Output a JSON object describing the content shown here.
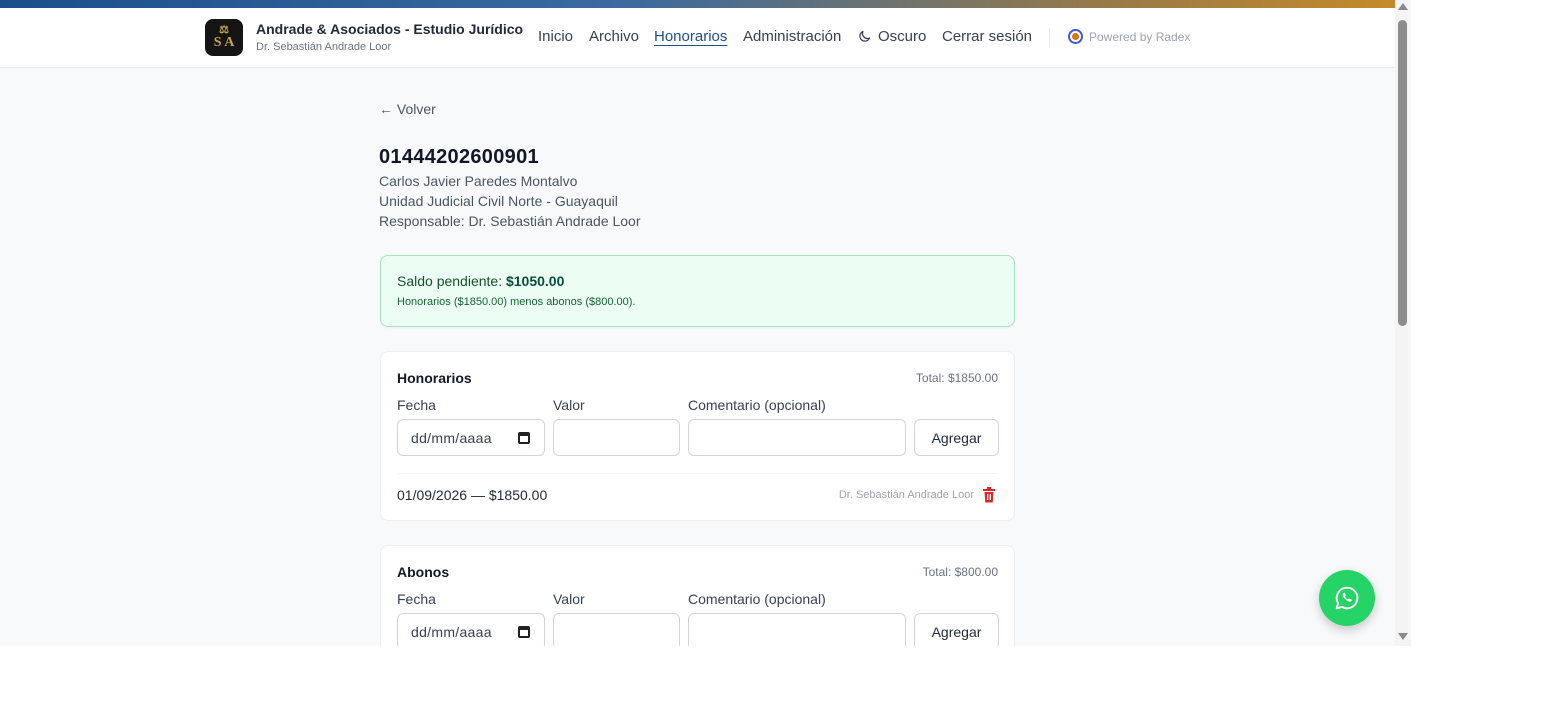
{
  "header": {
    "logo_text": "S A",
    "brand_title": "Andrade & Asociados - Estudio Jurídico",
    "brand_subtitle": "Dr. Sebastián Andrade Loor",
    "nav": {
      "inicio": "Inicio",
      "archivo": "Archivo",
      "honorarios": "Honorarios",
      "administracion": "Administración",
      "oscuro": "Oscuro",
      "cerrar_sesion": "Cerrar sesión"
    },
    "powered_by": "Powered by Radex",
    "active_nav": "honorarios"
  },
  "back_label": "← Volver",
  "case": {
    "number": "01444202600901",
    "client": "Carlos Javier Paredes Montalvo",
    "court": "Unidad Judicial Civil Norte - Guayaquil",
    "responsible": "Responsable: Dr. Sebastián Andrade Loor"
  },
  "balance": {
    "label": "Saldo pendiente:",
    "amount": "$1050.00",
    "note": "Honorarios ($1850.00) menos abonos ($800.00)."
  },
  "honorarios": {
    "title": "Honorarios",
    "total": "Total: $1850.00",
    "label_fecha": "Fecha",
    "label_valor": "Valor",
    "label_comentario": "Comentario (opcional)",
    "date_placeholder": "dd/mm/aaaa",
    "add_button": "Agregar",
    "entries": [
      {
        "text": "01/09/2026 — $1850.00",
        "user": "Dr. Sebastián Andrade Loor"
      }
    ]
  },
  "abonos": {
    "title": "Abonos",
    "total": "Total: $800.00",
    "label_fecha": "Fecha",
    "label_valor": "Valor",
    "label_comentario": "Comentario (opcional)",
    "date_placeholder": "dd/mm/aaaa",
    "add_button": "Agregar"
  },
  "colors": {
    "accent": "#1e4f8f",
    "success_bg": "#ecfdf3",
    "danger": "#dc2626",
    "whatsapp": "#25d366"
  },
  "icons": [
    "calendar-icon",
    "moon-icon",
    "trash-icon",
    "whatsapp-icon",
    "radex-icon"
  ]
}
